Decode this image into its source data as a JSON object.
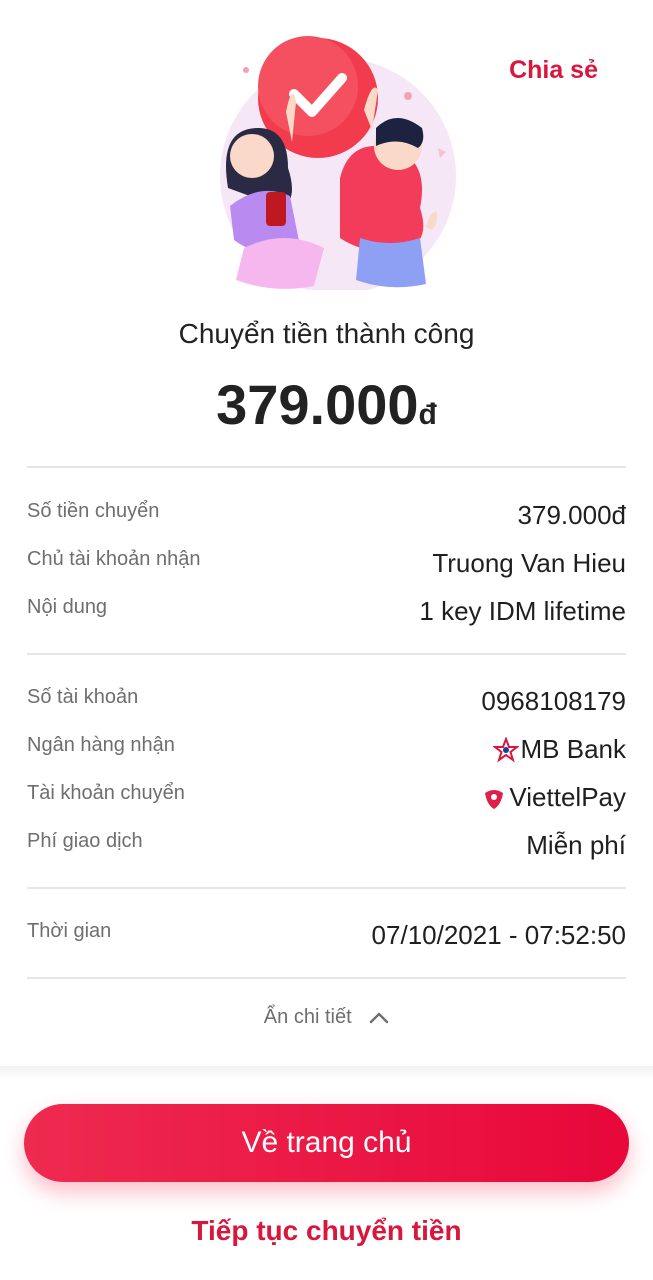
{
  "header": {
    "share_label": "Chia sẻ"
  },
  "result": {
    "title": "Chuyển tiền thành công",
    "amount": "379.000",
    "currency": "đ"
  },
  "details_group_1": [
    {
      "label": "Số tiền chuyển",
      "value": "379.000đ"
    },
    {
      "label": "Chủ tài khoản nhận",
      "value": "Truong Van Hieu"
    },
    {
      "label": "Nội dung",
      "value": "1 key IDM lifetime"
    }
  ],
  "details_group_2": [
    {
      "label": "Số tài khoản",
      "value": "0968108179"
    },
    {
      "label": "Ngân hàng nhận",
      "value": "MB Bank",
      "icon": "mb-bank-logo-icon"
    },
    {
      "label": "Tài khoản chuyển",
      "value": "ViettelPay",
      "icon": "viettelpay-logo-icon"
    },
    {
      "label": "Phí giao dịch",
      "value": "Miễn phí"
    }
  ],
  "details_group_3": [
    {
      "label": "Thời gian",
      "value": "07/10/2021 - 07:52:50"
    }
  ],
  "toggle": {
    "label": "Ẩn chi tiết",
    "icon": "chevron-up-icon"
  },
  "actions": {
    "home_label": "Về trang chủ",
    "continue_label": "Tiếp tục chuyển tiền"
  },
  "colors": {
    "accent": "#d9163c",
    "button_start": "#ee2a4f",
    "button_end": "#e8073a",
    "label_gray": "#6e6e6e"
  }
}
